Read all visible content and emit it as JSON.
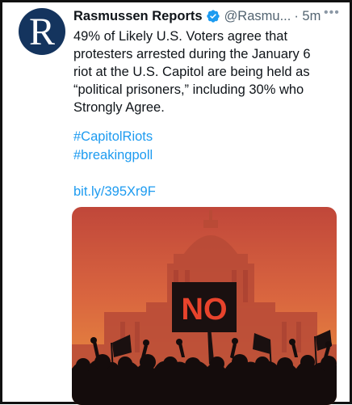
{
  "tweet": {
    "avatar_letter": "R",
    "author_name": "Rasmussen Reports",
    "handle": "@Rasmu...",
    "time": "· 5m",
    "more_icon": "more-dots-icon",
    "verified_icon": "verified-badge-icon",
    "text": "49% of Likely U.S. Voters agree that\nprotesters arrested during the January 6\nriot at the U.S. Capitol are being held as\n“political prisoners,” including 30% who\nStrongly Agree.",
    "hashtags": [
      "#CapitolRiots",
      "#breakingpoll"
    ],
    "url": "bit.ly/395Xr9F",
    "media": {
      "sign_text": "NO",
      "description_icon": "protest-crowd-image"
    }
  },
  "colors": {
    "accent": "#1d9bf0",
    "avatar_bg": "#14345e",
    "sign_text": "#e8432c"
  }
}
